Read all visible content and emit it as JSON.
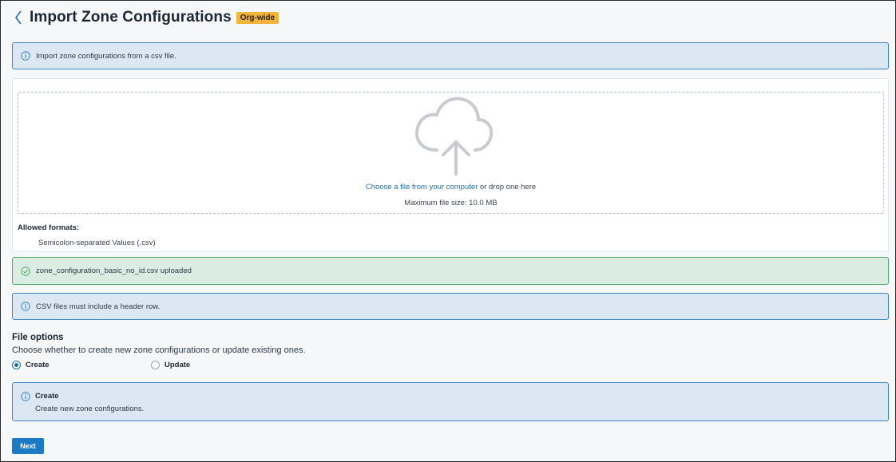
{
  "header": {
    "title": "Import Zone Configurations",
    "badge": "Org-wide"
  },
  "info_banner": {
    "icon": "info-icon",
    "text": "Import zone configurations from a csv file."
  },
  "upload": {
    "icon": "cloud-upload-icon",
    "link_text": "Choose a file from your computer",
    "drop_text": " or drop one here",
    "max_size": "Maximum file size: 10.0 MB",
    "allowed_label": "Allowed formats:",
    "allowed_formats": [
      "Semicolon-separated Values (.csv)"
    ]
  },
  "upload_status": {
    "icon": "check-circle-icon",
    "text": "zone_configuration_basic_no_id.csv uploaded",
    "color": "#4fae6c"
  },
  "csv_note": {
    "icon": "info-icon",
    "text": "CSV files must include a header row."
  },
  "file_options": {
    "title": "File options",
    "description": "Choose whether to create new zone configurations or update existing ones.",
    "options": [
      {
        "label": "Create",
        "selected": true
      },
      {
        "label": "Update",
        "selected": false
      }
    ]
  },
  "option_info": {
    "icon": "info-icon",
    "title": "Create",
    "description": "Create new zone configurations."
  },
  "actions": {
    "next_label": "Next"
  },
  "colors": {
    "accent": "#1b7bc7",
    "info_bg": "#dbe7f2",
    "success_bg": "#dbece2",
    "badge": "#f3b43b"
  }
}
